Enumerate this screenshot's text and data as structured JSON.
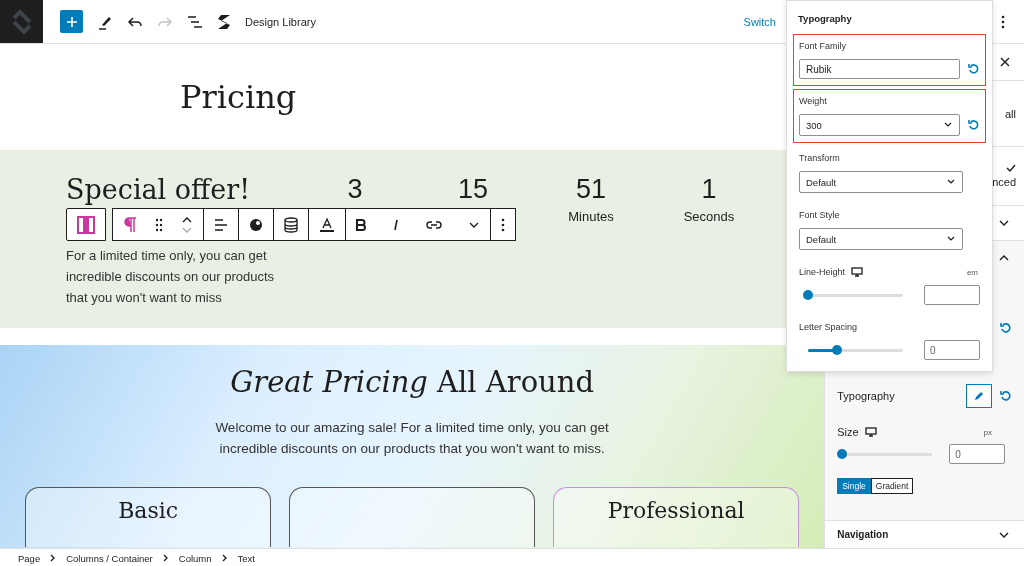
{
  "top_bar": {
    "library_label": "Design Library",
    "switch_link": "Switch",
    "redo_disabled": true
  },
  "canvas": {
    "page_title": "Pricing",
    "offer": {
      "heading": "Special offer!",
      "text": "For a limited time only, you can get incredible discounts on our products that you won't want to miss",
      "countdown": [
        {
          "value": "3"
        },
        {
          "value": "15"
        },
        {
          "value": "51",
          "label": "Minutes"
        },
        {
          "value": "1",
          "label": "Seconds"
        }
      ]
    },
    "pricing": {
      "heading": "*Great Pricing* All Around",
      "text": "Welcome to our amazing sale! For a limited time only, you can get incredible discounts on our products that you won't want to miss.",
      "cards": [
        {
          "title": "Basic",
          "selected": false
        },
        {
          "selected": false
        },
        {
          "title": "Professional",
          "selected": true
        }
      ]
    }
  },
  "popover": {
    "title": "Typography",
    "fields": [
      {
        "kind": "text",
        "label": "Font Family",
        "value": "Rubik",
        "highlighted": true,
        "resettable": true
      },
      {
        "kind": "select",
        "label": "Weight",
        "value": "300",
        "highlighted": true,
        "resettable": true
      },
      {
        "kind": "select",
        "label": "Transform",
        "value": "Default",
        "highlighted": false,
        "resettable": false
      },
      {
        "kind": "select",
        "label": "Font Style",
        "value": "Default",
        "highlighted": false,
        "resettable": false
      },
      {
        "kind": "slider",
        "label": "Line-Height",
        "unit": "em",
        "responsive": true,
        "level": 0,
        "highlighted": false
      },
      {
        "kind": "slider",
        "label": "Letter Spacing",
        "responsive": false,
        "level": 0.3,
        "value": "0",
        "highlighted": false
      }
    ]
  },
  "sidebar": {
    "partial_rows": [
      {
        "kind": "close"
      },
      {
        "kind": "text",
        "text": "all"
      },
      {
        "kind": "text",
        "text": "nced",
        "checked": true
      },
      {
        "kind": "chevron",
        "expanded": false
      },
      {
        "kind": "chevron",
        "expanded": true
      },
      {
        "kind": "reset"
      }
    ],
    "typography_label": "Typography",
    "size": {
      "label": "Size",
      "unit": "px",
      "level": 0,
      "value": "0"
    },
    "color_modes": [
      {
        "label": "Single",
        "selected": true
      },
      {
        "label": "Gradient",
        "selected": false
      }
    ],
    "navigation": {
      "label": "Navigation",
      "expanded": false
    }
  },
  "breadcrumbs": [
    "Page",
    "Columns / Container",
    "Column",
    "Text"
  ]
}
